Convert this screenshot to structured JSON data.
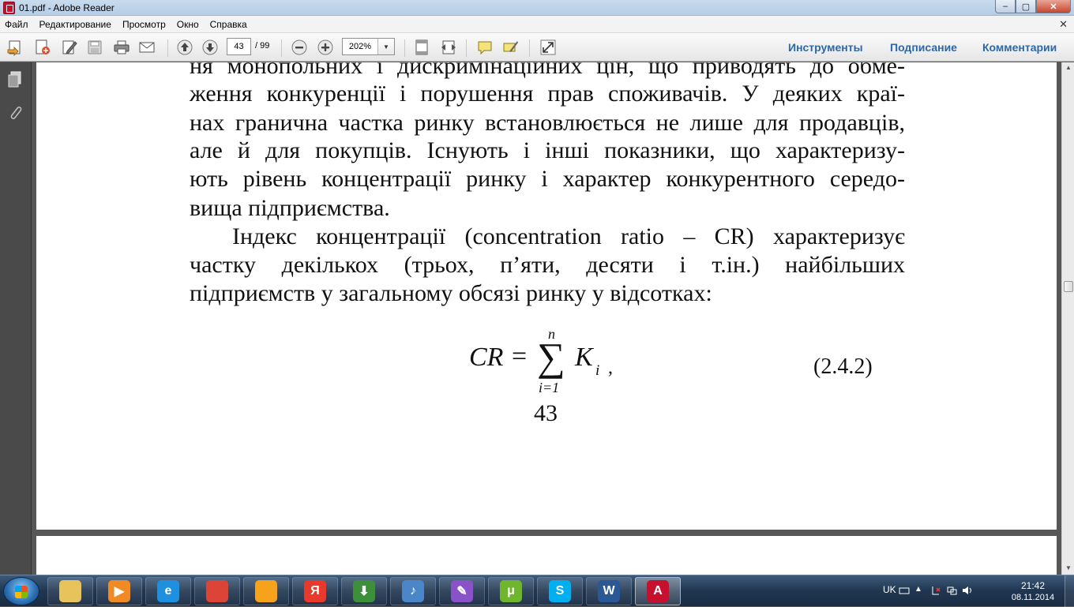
{
  "window": {
    "title": "01.pdf - Adobe Reader",
    "controls": [
      "–",
      "▢",
      "✕"
    ]
  },
  "menu": [
    "Файл",
    "Редактирование",
    "Просмотр",
    "Окно",
    "Справка"
  ],
  "toolbar": {
    "page_current": "43",
    "page_total": "/ 99",
    "zoom": "202%",
    "panels": [
      "Инструменты",
      "Подписание",
      "Комментарии"
    ]
  },
  "document": {
    "lines": [
      "ня монопольних і дискримінаційних цін, що приводять до обме-",
      "ження конкуренції і порушення прав споживачів. У деяких краї-",
      "нах гранична частка ринку встановлюється не лише для продавців,",
      "але й для покупців. Існують і інші показники, що характеризу-",
      "ють рівень концентрації ринку і характер конкурентного середо-",
      "вища підприємства.",
      "Індекс концентрації (concentration ratio – CR) характеризує",
      "частку декількох (трьох, п’яти, десяти і т.ін.) найбільших",
      "підприємств у загальному обсязі ринку у відсотках:"
    ],
    "formula": {
      "lhs": "CR",
      "equals": "=",
      "sum": "∑",
      "upper": "n",
      "lower": "i=1",
      "term": "K",
      "subscript": "i",
      "comma": ",",
      "number": "(2.4.2)"
    },
    "page_number": "43"
  },
  "taskbar": {
    "language": "UK",
    "time": "21:42",
    "date": "08.11.2014",
    "apps": [
      {
        "name": "explorer-icon",
        "color": "#e8c25a",
        "glyph": ""
      },
      {
        "name": "media-player-icon",
        "color": "#f08a24",
        "glyph": "▶"
      },
      {
        "name": "internet-explorer-icon",
        "color": "#1f8fe0",
        "glyph": "e"
      },
      {
        "name": "chrome-icon",
        "color": "#db4437",
        "glyph": ""
      },
      {
        "name": "orange-app-icon",
        "color": "#f7a21b",
        "glyph": ""
      },
      {
        "name": "yandex-icon",
        "color": "#e8392b",
        "glyph": "Я"
      },
      {
        "name": "download-manager-icon",
        "color": "#3d8f3a",
        "glyph": "⬇"
      },
      {
        "name": "audio-icon",
        "color": "#4a86c8",
        "glyph": "♪"
      },
      {
        "name": "stylus-app-icon",
        "color": "#8a52c7",
        "glyph": "✎"
      },
      {
        "name": "utorrent-icon",
        "color": "#6fb62e",
        "glyph": "μ"
      },
      {
        "name": "skype-icon",
        "color": "#00aff0",
        "glyph": "S"
      },
      {
        "name": "word-icon",
        "color": "#2b5797",
        "glyph": "W"
      },
      {
        "name": "adobe-reader-icon",
        "color": "#c8102e",
        "glyph": "A"
      }
    ]
  }
}
